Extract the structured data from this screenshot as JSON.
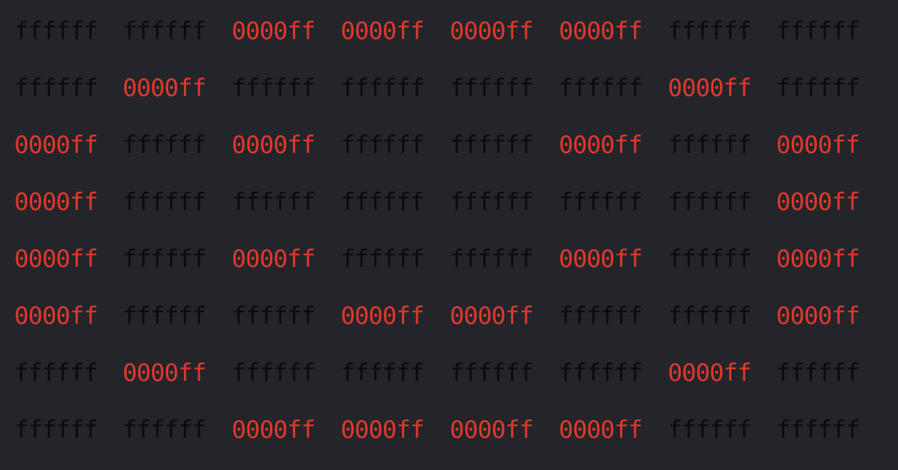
{
  "rows": [
    [
      "ffffff",
      "ffffff",
      "0000ff",
      "0000ff",
      "0000ff",
      "0000ff",
      "ffffff",
      "ffffff"
    ],
    [
      "ffffff",
      "0000ff",
      "ffffff",
      "ffffff",
      "ffffff",
      "ffffff",
      "0000ff",
      "ffffff"
    ],
    [
      "0000ff",
      "ffffff",
      "0000ff",
      "ffffff",
      "ffffff",
      "0000ff",
      "ffffff",
      "0000ff"
    ],
    [
      "0000ff",
      "ffffff",
      "ffffff",
      "ffffff",
      "ffffff",
      "ffffff",
      "ffffff",
      "0000ff"
    ],
    [
      "0000ff",
      "ffffff",
      "0000ff",
      "ffffff",
      "ffffff",
      "0000ff",
      "ffffff",
      "0000ff"
    ],
    [
      "0000ff",
      "ffffff",
      "ffffff",
      "0000ff",
      "0000ff",
      "ffffff",
      "ffffff",
      "0000ff"
    ],
    [
      "ffffff",
      "0000ff",
      "ffffff",
      "ffffff",
      "ffffff",
      "ffffff",
      "0000ff",
      "ffffff"
    ],
    [
      "ffffff",
      "ffffff",
      "0000ff",
      "0000ff",
      "0000ff",
      "0000ff",
      "ffffff",
      "ffffff"
    ]
  ],
  "colors": {
    "background": "#23252a",
    "ffffff": "#0b0b0c",
    "0000ff": "#e0382b"
  }
}
